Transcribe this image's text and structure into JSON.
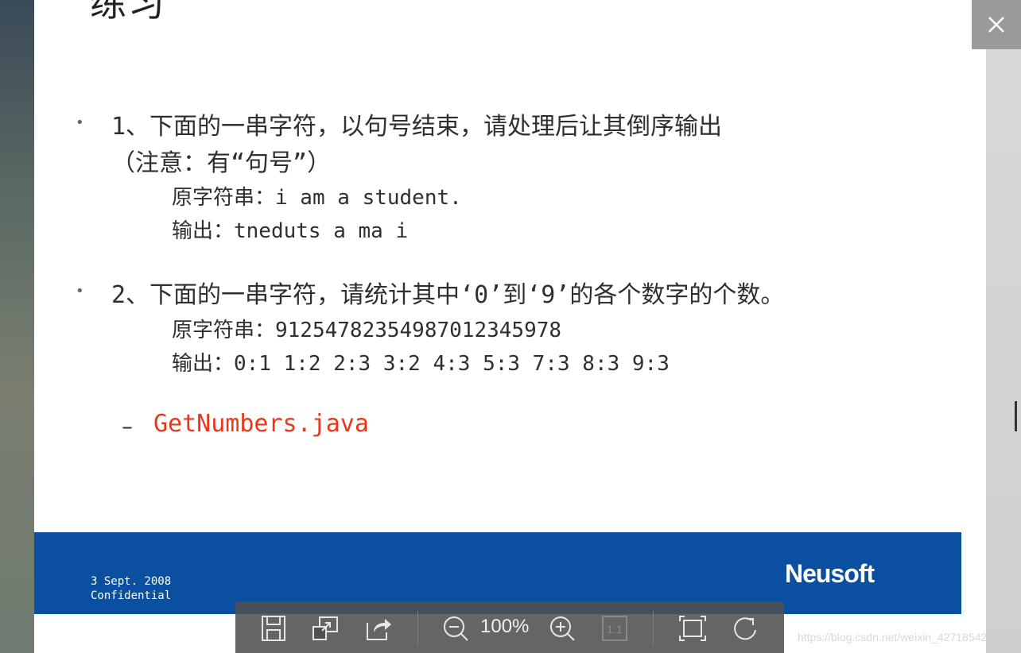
{
  "slide": {
    "title": "练习",
    "item1": {
      "line1": "1、下面的一串字符，以句号结束，请处理后让其倒序输出",
      "line2": "（注意：有“句号”）",
      "line3": "原字符串：i am a student.",
      "line4": "输出：tneduts a ma i"
    },
    "item2": {
      "line1": "2、下面的一串字符，请统计其中‘0’到‘9’的各个数字的个数。",
      "line2": "原字符串：9125478235498701234597 8",
      "line3": "输出：0:1 1:2 2:3 3:2 4:3 5:3 7:3 8:3 9:3"
    },
    "sub_item": {
      "dash": "–",
      "file": "GetNumbers.java"
    },
    "footer": {
      "date": "3 Sept. 2008",
      "confidential": "Confidential",
      "logo": "Neusoft",
      "color": "#0b4fa0"
    }
  },
  "viewer": {
    "close_icon": "close-icon",
    "zoom": "100%",
    "actual_size_label": "1:1",
    "toolbar_icons": [
      "save-icon",
      "restore-window-icon",
      "share-icon",
      "zoom-out-icon",
      "zoom-in-icon",
      "actual-size-icon",
      "fit-screen-icon",
      "rotate-icon"
    ]
  },
  "watermark": "https://blog.csdn.net/weixin_42718542"
}
